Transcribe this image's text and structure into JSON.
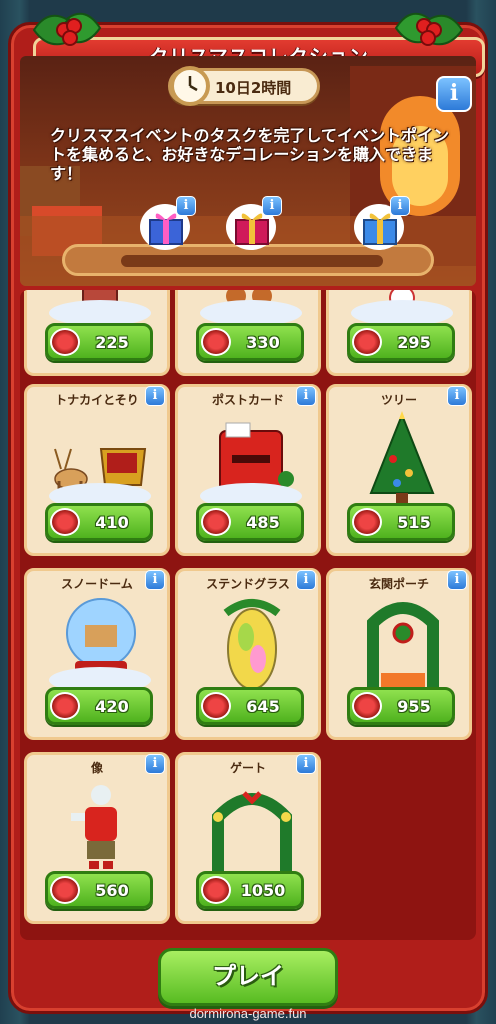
{
  "header": {
    "title": "クリスマスコレクション"
  },
  "event": {
    "timer": "10日2時間",
    "description": "クリスマスイベントのタスクを完了してイベントポイントを集めると、お好きなデコレーションを購入できます！"
  },
  "progress": {
    "value": 0
  },
  "rewards": [
    {
      "icon": "gift-box-icon"
    },
    {
      "icon": "gift-box-icon"
    },
    {
      "icon": "gift-box-icon"
    }
  ],
  "items": [
    {
      "title": "",
      "price": "225"
    },
    {
      "title": "",
      "price": "330"
    },
    {
      "title": "",
      "price": "295"
    },
    {
      "title": "トナカイとそり",
      "price": "410"
    },
    {
      "title": "ポストカード",
      "price": "485"
    },
    {
      "title": "ツリー",
      "price": "515"
    },
    {
      "title": "スノードーム",
      "price": "420"
    },
    {
      "title": "ステンドグラス",
      "price": "645"
    },
    {
      "title": "玄関ポーチ",
      "price": "955"
    },
    {
      "title": "像",
      "price": "560"
    },
    {
      "title": "ゲート",
      "price": "1050"
    }
  ],
  "info_label": "i",
  "play_button": "プレイ",
  "watermark": "dormirona-game.fun"
}
